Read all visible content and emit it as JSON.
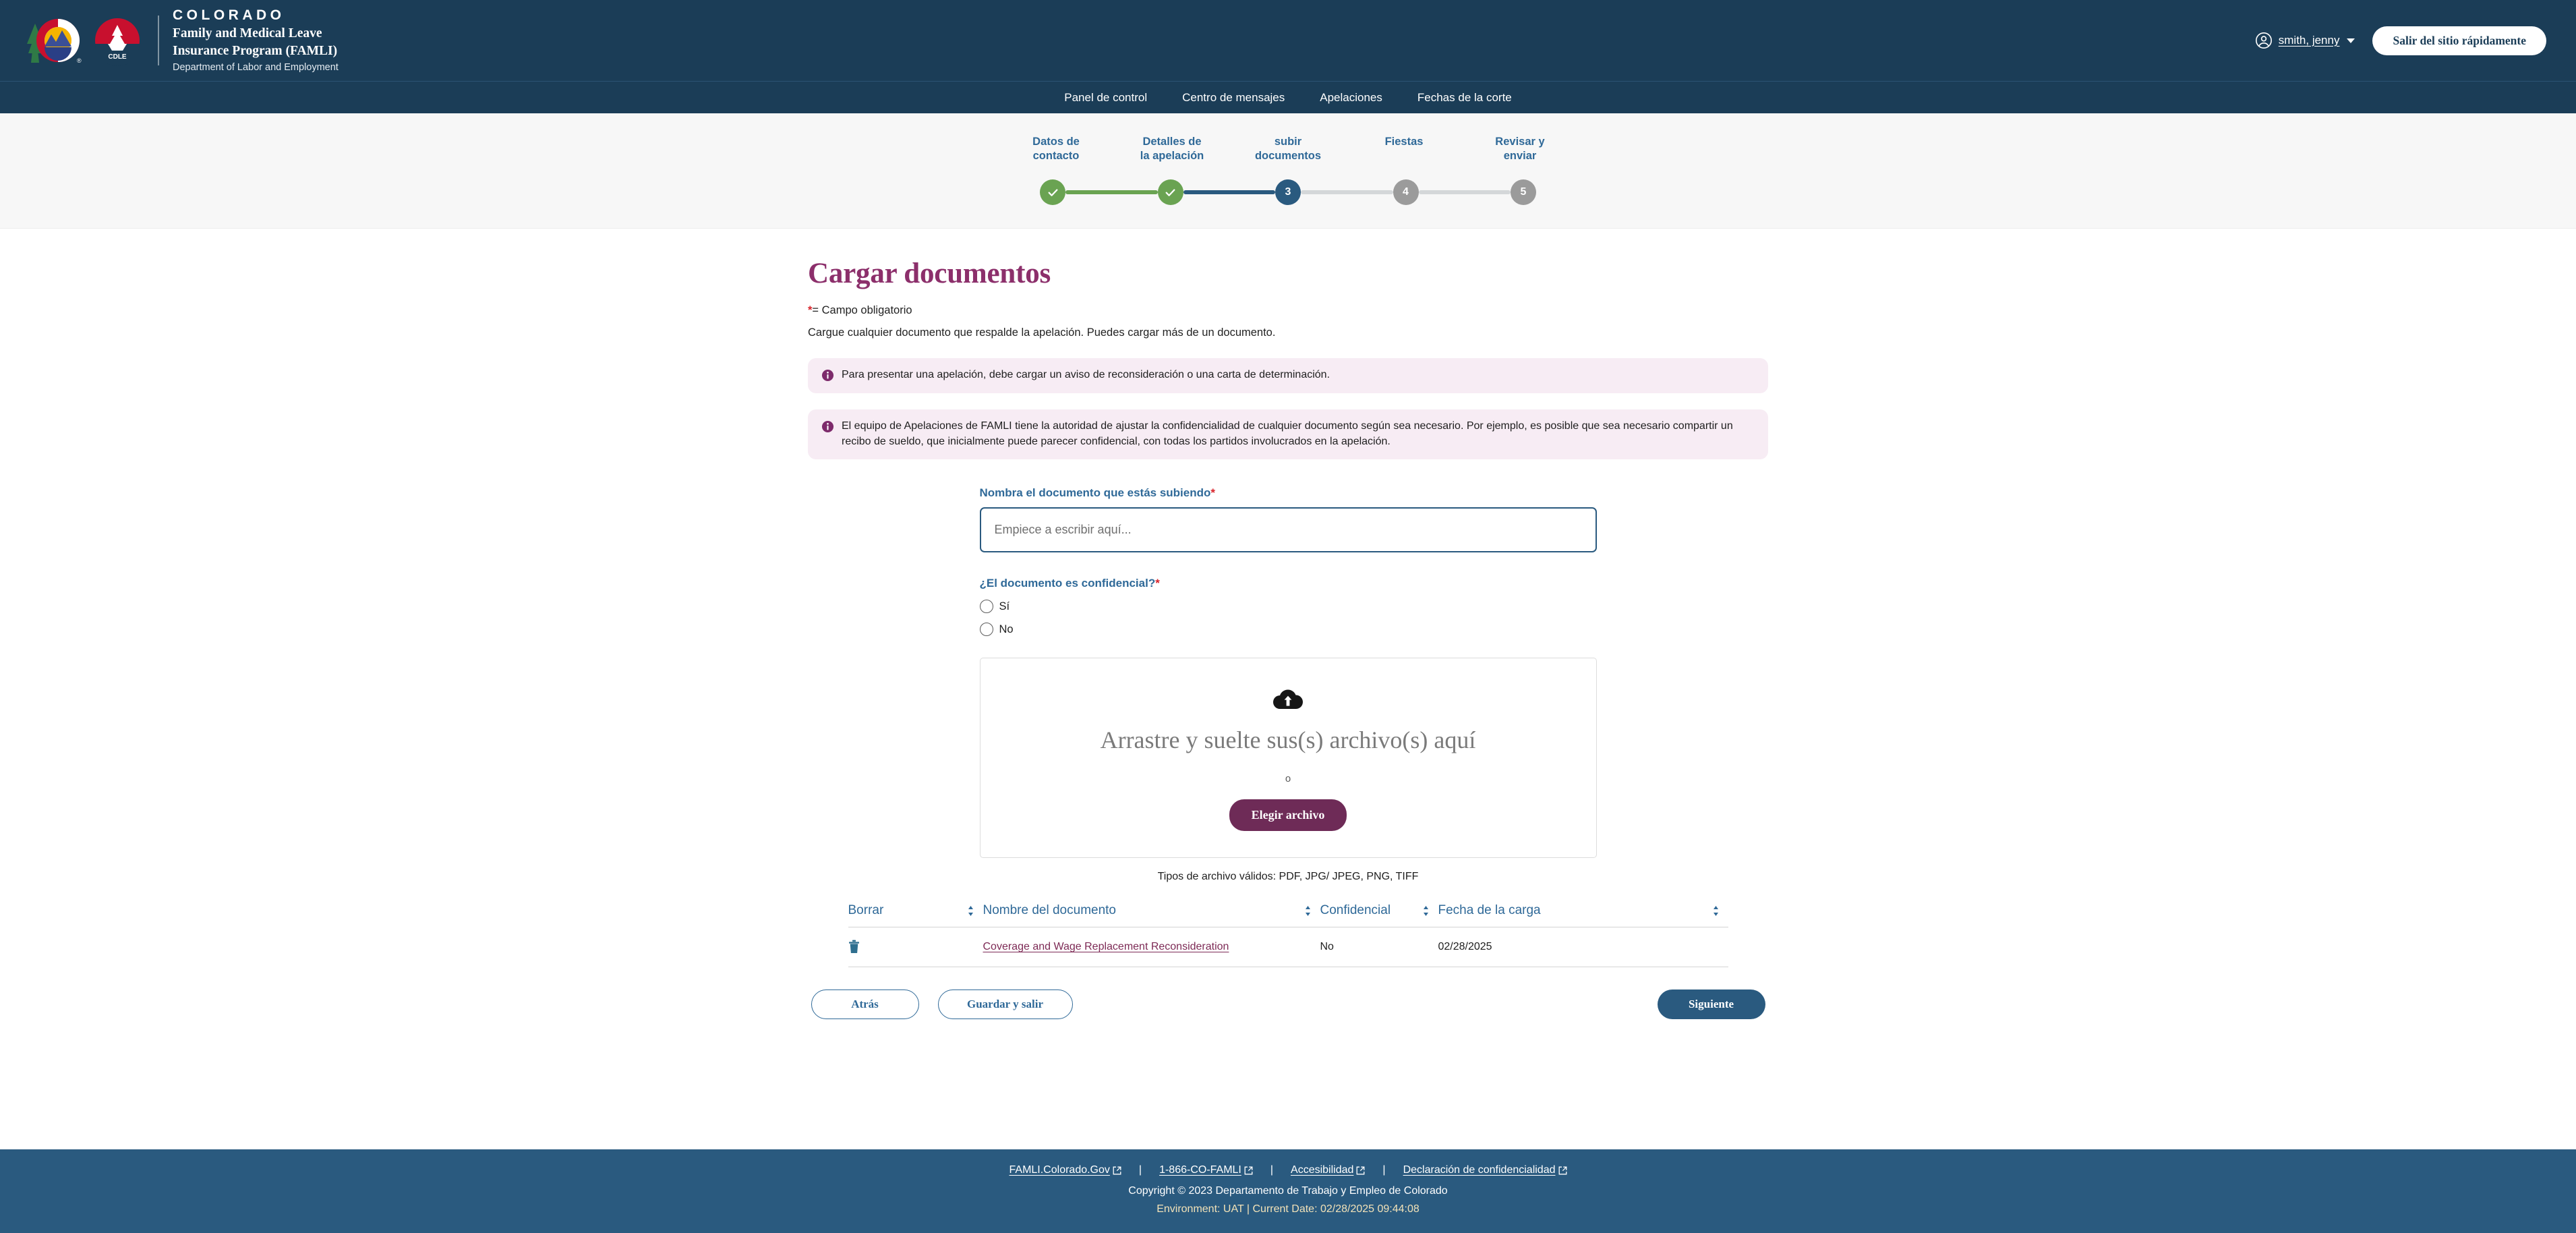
{
  "header": {
    "brand": {
      "state": "COLORADO",
      "program_line1": "Family and Medical Leave",
      "program_line2": "Insurance Program (FAMLI)",
      "department": "Department of Labor and Employment",
      "cdle_label": "CDLE"
    },
    "user_name": "smith, jenny",
    "exit_button": "Salir del sitio rápidamente",
    "colors": {
      "bar": "#1b3d57",
      "accent_blue": "#2a5a7f"
    }
  },
  "nav": {
    "items": [
      {
        "label": "Panel de control"
      },
      {
        "label": "Centro de mensajes"
      },
      {
        "label": "Apelaciones"
      },
      {
        "label": "Fechas de la corte"
      }
    ]
  },
  "stepper": {
    "steps": [
      {
        "label": "Datos de\ncontacto",
        "label_l1": "Datos de",
        "label_l2": "contacto",
        "marker": "✓",
        "state": "done"
      },
      {
        "label": "Detalles de\nla apelación",
        "label_l1": "Detalles de",
        "label_l2": "la apelación",
        "marker": "✓",
        "state": "done"
      },
      {
        "label": "subir\ndocumentos",
        "label_l1": "subir",
        "label_l2": "documentos",
        "marker": "3",
        "state": "active"
      },
      {
        "label": "Fiestas",
        "label_l1": "Fiestas",
        "label_l2": "",
        "marker": "4",
        "state": "todo"
      },
      {
        "label": "Revisar y\nenviar",
        "label_l1": "Revisar y",
        "label_l2": "enviar",
        "marker": "5",
        "state": "todo"
      }
    ],
    "colors": {
      "done": "#6aa352",
      "active": "#2a5a7f",
      "todo": "#9b9b9b",
      "pending_track": "#d4d7d9"
    }
  },
  "main": {
    "title": "Cargar documentos",
    "required_star": "*",
    "required_note": "= Campo obligatorio",
    "intro": "Cargue cualquier documento que respalde la apelación. Puedes cargar más de un documento.",
    "alerts": [
      {
        "text": "Para presentar una apelación, debe cargar un aviso de reconsideración o una carta de determinación."
      },
      {
        "text": "El equipo de Apelaciones de FAMLI tiene la autoridad de ajustar la confidencialidad de cualquier documento según sea necesario. Por ejemplo, es posible que sea necesario compartir un recibo de sueldo, que inicialmente puede parecer confidencial, con todas los partidos involucrados en la apelación."
      }
    ],
    "form": {
      "doc_name_label": "Nombra el documento que estás subiendo",
      "doc_name_star": "*",
      "doc_name_value": "",
      "doc_name_placeholder": "Empiece a escribir aquí...",
      "confidential_label": "¿El documento es confidencial?",
      "confidential_star": "*",
      "radios": [
        {
          "label": "Sí",
          "checked": false
        },
        {
          "label": "No",
          "checked": false
        }
      ]
    },
    "dropzone": {
      "title": "Arrastre y suelte sus(s) archivo(s)  aquí",
      "or": "o",
      "choose_button": "Elegir archivo",
      "file_types": "Tipos de archivo válidos: PDF, JPG/ JPEG, PNG, TIFF"
    },
    "table": {
      "columns": [
        {
          "label": "Borrar",
          "sortable": true
        },
        {
          "label": "Nombre del documento",
          "sortable": true
        },
        {
          "label": "Confidencial",
          "sortable": true
        },
        {
          "label": "Fecha de la carga",
          "sortable": true
        }
      ],
      "rows": [
        {
          "delete_icon": "trash-icon",
          "name": "Coverage and Wage Replacement Reconsideration",
          "confidential": "No",
          "upload_date": "02/28/2025"
        }
      ]
    },
    "actions": {
      "back": "Atrás",
      "save_exit": "Guardar y salir",
      "next": "Siguiente"
    }
  },
  "footer": {
    "links": [
      {
        "label": "FAMLI.Colorado.Gov",
        "external": true
      },
      {
        "label": "1-866-CO-FAMLI",
        "external": true
      },
      {
        "label": "Accesibilidad",
        "external": true
      },
      {
        "label": "Declaración de confidencialidad",
        "external": true
      }
    ],
    "separator": "|",
    "copyright": "Copyright © 2023 Departamento de Trabajo y Empleo de Colorado",
    "environment": "Environment: UAT | Current Date: 02/28/2025 09:44:08"
  }
}
